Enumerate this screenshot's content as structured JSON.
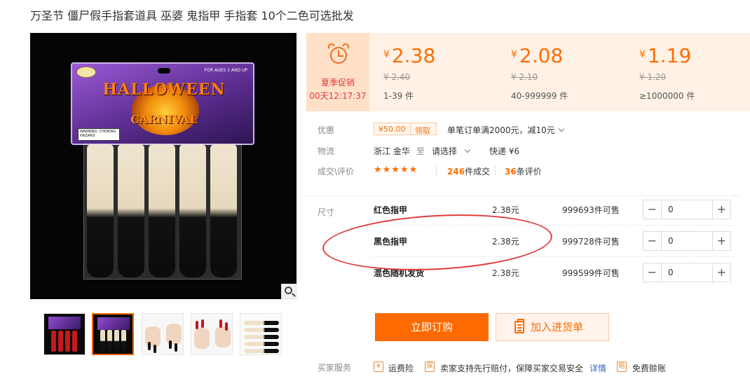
{
  "title": "万圣节 僵尸假手指套道具 巫婆 鬼指甲 手指套 10个二色可选批发",
  "gallery": {
    "package": {
      "header_main": "HALLOWEEN",
      "header_sub": "CARNIVAL",
      "ages": "FOR AGES 3 AND UP",
      "warning": "WARNING: CHOKING HAZARD"
    },
    "zoom_icon": "search-icon",
    "thumbnails": [
      {
        "kind": "package-red",
        "active": false
      },
      {
        "kind": "package-black",
        "active": true
      },
      {
        "kind": "hands-black-nails",
        "active": false
      },
      {
        "kind": "hands-red-nails",
        "active": false
      },
      {
        "kind": "fingers-stack",
        "active": false
      }
    ]
  },
  "promo": {
    "icon": "alarm-clock-icon",
    "label": "夏季促销",
    "countdown": "00天12:17:37"
  },
  "price_tiers": [
    {
      "currency": "¥",
      "price": "2.38",
      "old_price": "¥ 2.40",
      "quantity": "1-39 件"
    },
    {
      "currency": "¥",
      "price": "2.08",
      "old_price": "¥ 2.10",
      "quantity": "40-999999 件"
    },
    {
      "currency": "¥",
      "price": "1.19",
      "old_price": "¥ 1.20",
      "quantity": "≥1000000 件"
    }
  ],
  "discount": {
    "label": "优惠",
    "coupon_amount": "¥50.00",
    "coupon_action": "领取",
    "description": "单笔订单满2000元，减10元"
  },
  "logistics": {
    "label": "物流",
    "from": "浙江 金华",
    "to_word": "至",
    "destination": "请选择",
    "shipping": "快递 ¥6"
  },
  "deals": {
    "label": "成交\\评价",
    "stars": "★★★★★",
    "deals_count": "246",
    "deals_suffix": "件成交",
    "reviews_count": "36",
    "reviews_suffix": "条评价"
  },
  "sku": {
    "label": "尺寸",
    "rows": [
      {
        "name": "红色指甲",
        "price": "2.38元",
        "stock": "999693件可售",
        "qty": "0"
      },
      {
        "name": "黑色指甲",
        "price": "2.38元",
        "stock": "999728件可售",
        "qty": "0"
      },
      {
        "name": "混色随机发货",
        "price": "2.38元",
        "stock": "999599件可售",
        "qty": "0"
      }
    ],
    "minus": "−",
    "plus": "+"
  },
  "actions": {
    "order": "立即订购",
    "cart": "加入进货单"
  },
  "services": {
    "label": "买家服务",
    "items": [
      {
        "icon": "shipping-insurance-icon",
        "glyph": "¥",
        "text": "运费险"
      },
      {
        "icon": "shield-icon",
        "glyph": "保",
        "text": "卖家支持先行赔付，保障买家交易安全"
      },
      {
        "icon": "compensation-icon",
        "glyph": "赔",
        "text": "免费赊账"
      }
    ],
    "detail_link": "详情"
  },
  "colors": {
    "accent": "#ff6a00",
    "price_bg": "#fff1e6",
    "promo_text": "#e4393c",
    "annotation_ellipse": "#e23a3a"
  }
}
